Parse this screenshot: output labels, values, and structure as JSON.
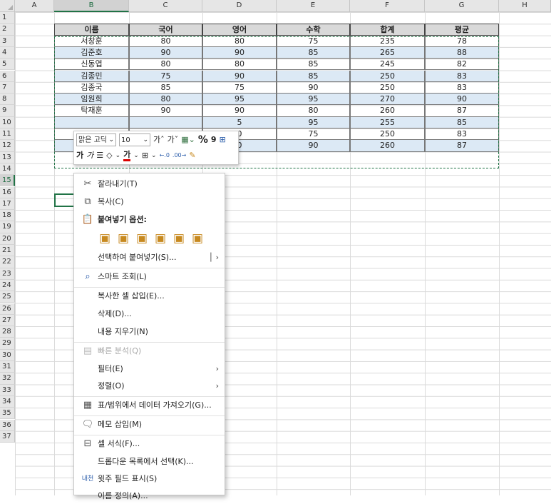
{
  "columns": [
    "A",
    "B",
    "C",
    "D",
    "E",
    "F",
    "G",
    "H"
  ],
  "rows": [
    "1",
    "2",
    "3",
    "4",
    "5",
    "6",
    "7",
    "8",
    "9",
    "10",
    "11",
    "12",
    "13",
    "14",
    "15",
    "16",
    "17",
    "18",
    "19",
    "20",
    "21",
    "22",
    "23",
    "24",
    "25",
    "26",
    "27",
    "28",
    "29",
    "30",
    "31",
    "32",
    "33",
    "34",
    "35",
    "36",
    "37"
  ],
  "table": {
    "headers": [
      "이름",
      "국어",
      "영어",
      "수학",
      "합계",
      "평균"
    ],
    "rows": [
      [
        "서창훈",
        "80",
        "80",
        "75",
        "235",
        "78"
      ],
      [
        "김준호",
        "90",
        "90",
        "85",
        "265",
        "88"
      ],
      [
        "신동엽",
        "80",
        "80",
        "85",
        "245",
        "82"
      ],
      [
        "김종민",
        "75",
        "90",
        "85",
        "250",
        "83"
      ],
      [
        "김종국",
        "85",
        "75",
        "90",
        "250",
        "83"
      ],
      [
        "임원희",
        "80",
        "95",
        "95",
        "270",
        "90"
      ],
      [
        "탁재훈",
        "90",
        "90",
        "80",
        "260",
        "87"
      ],
      [
        "",
        "",
        "5",
        "95",
        "255",
        "85"
      ],
      [
        "",
        "",
        "0",
        "75",
        "250",
        "83"
      ],
      [
        "",
        "",
        "0",
        "90",
        "260",
        "87"
      ]
    ]
  },
  "mini_toolbar": {
    "font_name": "맑은 고딕",
    "font_size": "10",
    "grow": "가ˆ",
    "shrink": "가ˇ",
    "percent": "%",
    "comma": "9",
    "bold": "가",
    "italic": "가",
    "align": "☰",
    "fill_arrow": "⌄",
    "font_color": "가",
    "border_arrow": "⌄"
  },
  "menu": {
    "cut": "잘라내기(T)",
    "copy": "복사(C)",
    "paste_options": "붙여넣기 옵션:",
    "paste_special": "선택하여 붙여넣기(S)...",
    "smart_lookup": "스마트 조회(L)",
    "insert_copied": "복사한 셀 삽입(E)...",
    "delete": "삭제(D)...",
    "clear": "내용 지우기(N)",
    "quick_analysis": "빠른 분석(Q)",
    "filter": "필터(E)",
    "sort": "정렬(O)",
    "get_data": "표/범위에서 데이터 가져오기(G)...",
    "insert_comment": "메모 삽입(M)",
    "format_cells": "셀 서식(F)...",
    "dropdown_pick": "드롭다운 목록에서 선택(K)...",
    "phonetic": "윗주 필드 표시(S)",
    "define_name": "이름 정의(A)..."
  },
  "colors": {
    "accent": "#217346",
    "band": "#dce9f5",
    "header": "#d9d9d9"
  }
}
